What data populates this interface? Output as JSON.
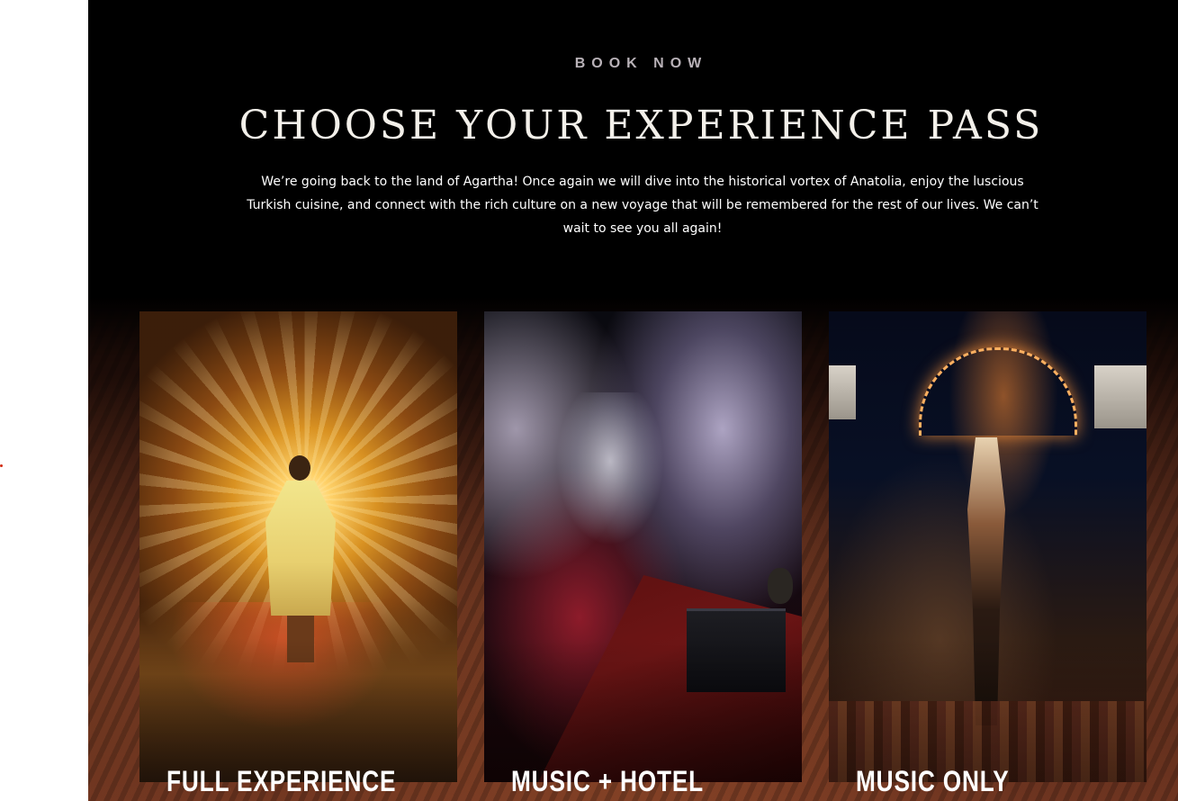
{
  "section": {
    "eyebrow": "BOOK NOW",
    "headline": "CHOOSE YOUR EXPERIENCE PASS",
    "intro": "We’re going back to the land of Agartha! Once again we will dive into the historical vortex of Anatolia, enjoy the luscious Turkish cuisine, and connect with the rich culture on a new voyage that will be remembered for the rest of our lives. We can’t wait to see you all again!"
  },
  "passes": [
    {
      "title": "FULL EXPERIENCE",
      "image": "light-tunnel-robed-figure-photo"
    },
    {
      "title": "MUSIC + HOTEL",
      "image": "cave-dj-party-photo"
    },
    {
      "title": "MUSIC ONLY",
      "image": "fire-headdress-dancer-photo"
    }
  ],
  "colors": {
    "page_background": "#000000",
    "eyebrow": "#b9b2b8",
    "headline": "#f3f0ea",
    "text": "#ffffff",
    "left_strip": "#ffffff",
    "dot_accent": "#d22a12"
  }
}
